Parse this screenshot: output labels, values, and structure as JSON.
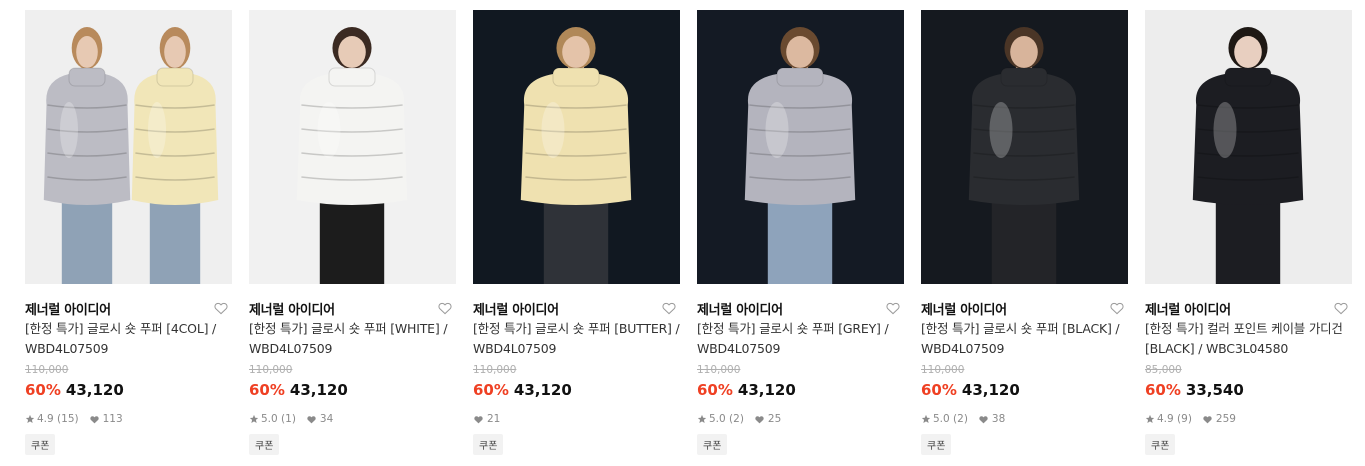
{
  "products": [
    {
      "brand": "제너럴 아이디어",
      "name": "[한정 특가] 글로시 숏 푸퍼 [4COL] / WBD4L07509",
      "original_price": "110,000",
      "discount": "60%",
      "price": "43,120",
      "rating": "4.9 (15)",
      "likes": "113",
      "badge": "쿠폰",
      "colors": {
        "bg": "#efefef",
        "jacket": "#bcbcc4",
        "jacket2": "#f1e6b8",
        "skin": "#e7c9b3",
        "hair": "#b88a5c",
        "bottom": "#8fa2b6"
      }
    },
    {
      "brand": "제너럴 아이디어",
      "name": "[한정 특가] 글로시 숏 푸퍼 [WHITE] / WBD4L07509",
      "original_price": "110,000",
      "discount": "60%",
      "price": "43,120",
      "rating": "5.0 (1)",
      "likes": "34",
      "badge": "쿠폰",
      "colors": {
        "bg": "#f1f1f1",
        "jacket": "#f4f4f2",
        "skin": "#e7cbb7",
        "hair": "#3b2a22",
        "bottom": "#1c1c1c"
      }
    },
    {
      "brand": "제너럴 아이디어",
      "name": "[한정 특가] 글로시 숏 푸퍼 [BUTTER] / WBD4L07509",
      "original_price": "110,000",
      "discount": "60%",
      "price": "43,120",
      "rating": "",
      "likes": "21",
      "badge": "쿠폰",
      "colors": {
        "bg": "#111821",
        "jacket": "#efe1b0",
        "skin": "#e4c3a9",
        "hair": "#b08858",
        "bottom": "#2f3238"
      }
    },
    {
      "brand": "제너럴 아이디어",
      "name": "[한정 특가] 글로시 숏 푸퍼 [GREY] / WBD4L07509",
      "original_price": "110,000",
      "discount": "60%",
      "price": "43,120",
      "rating": "5.0 (2)",
      "likes": "25",
      "badge": "쿠폰",
      "colors": {
        "bg": "#141a24",
        "jacket": "#b4b4be",
        "skin": "#dcb9a0",
        "hair": "#6a4a30",
        "bottom": "#8ea3bb"
      }
    },
    {
      "brand": "제너럴 아이디어",
      "name": "[한정 특가] 글로시 숏 푸퍼 [BLACK] / WBD4L07509",
      "original_price": "110,000",
      "discount": "60%",
      "price": "43,120",
      "rating": "5.0 (2)",
      "likes": "38",
      "badge": "쿠폰",
      "colors": {
        "bg": "#15191f",
        "jacket": "#2a2c30",
        "skin": "#d8b49b",
        "hair": "#4a3526",
        "bottom": "#232428"
      }
    },
    {
      "brand": "제너럴 아이디어",
      "name": "[한정 특가] 컬러 포인트 케이블 가디건 [BLACK] / WBC3L04580",
      "original_price": "85,000",
      "discount": "60%",
      "price": "33,540",
      "rating": "4.9 (9)",
      "likes": "259",
      "badge": "쿠폰",
      "colors": {
        "bg": "#ededed",
        "jacket": "#1c1d22",
        "skin": "#e8cfc0",
        "hair": "#1e1814",
        "bottom": "#1c1d22"
      }
    }
  ],
  "icons": {
    "like": "heart-outline-icon",
    "star": "star-icon",
    "likes": "heart-filled-icon"
  }
}
